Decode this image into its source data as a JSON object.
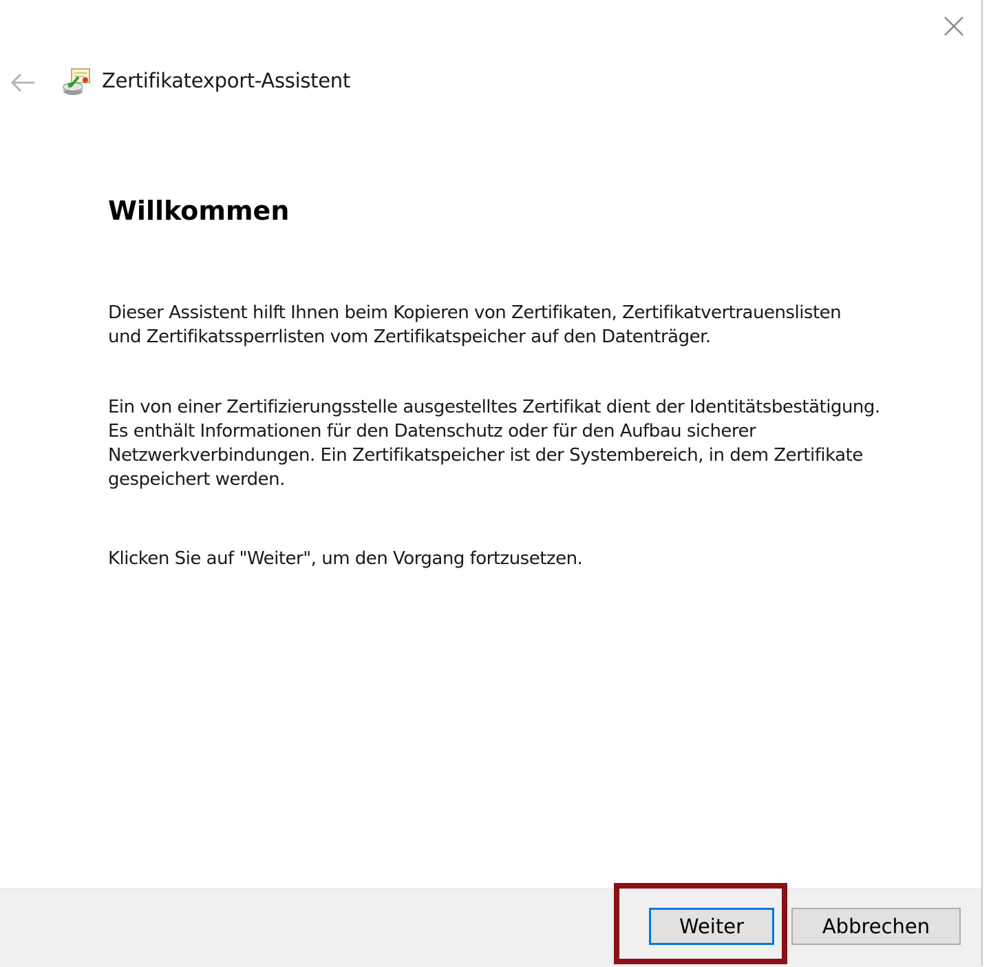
{
  "wizard": {
    "title": "Zertifikatexport-Assistent",
    "back_icon": "back-arrow-icon",
    "app_icon": "certificate-wizard-icon",
    "close_icon": "close-icon"
  },
  "content": {
    "heading": "Willkommen",
    "paragraph1": [
      "Dieser Assistent hilft Ihnen beim Kopieren von Zertifikaten, Zertifikatvertrauenslisten",
      "und Zertifikatssperrlisten vom Zertifikatspeicher auf den Datenträger."
    ],
    "paragraph2": [
      "Ein von einer Zertifizierungsstelle ausgestelltes Zertifikat dient der Identitätsbestätigung.",
      "Es enthält Informationen für den Datenschutz oder für den Aufbau sicherer",
      "Netzwerkverbindungen. Ein Zertifikatspeicher ist der Systembereich, in dem Zertifikate",
      "gespeichert werden."
    ],
    "paragraph3": "Klicken Sie auf \"Weiter\", um den Vorgang fortzusetzen."
  },
  "footer": {
    "next_label": "Weiter",
    "cancel_label": "Abbrechen"
  },
  "colors": {
    "highlight": "#8b1018",
    "focus": "#0078d7",
    "footer_bg": "#f0f0f0"
  }
}
